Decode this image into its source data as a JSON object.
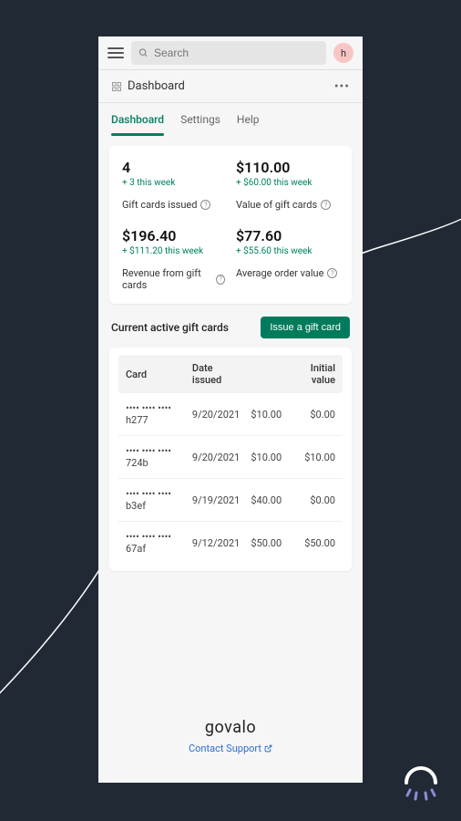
{
  "search": {
    "placeholder": "Search"
  },
  "avatar": {
    "initial": "h"
  },
  "breadcrumb": {
    "title": "Dashboard"
  },
  "tabs": [
    {
      "label": "Dashboard",
      "active": true
    },
    {
      "label": "Settings",
      "active": false
    },
    {
      "label": "Help",
      "active": false
    }
  ],
  "stats": [
    {
      "value": "4",
      "delta": "+ 3 this week",
      "label": "Gift cards issued"
    },
    {
      "value": "$110.00",
      "delta": "+ $60.00 this week",
      "label": "Value of gift cards"
    },
    {
      "value": "$196.40",
      "delta": "+ $111.20 this week",
      "label": "Revenue from gift cards"
    },
    {
      "value": "$77.60",
      "delta": "+ $55.60 this week",
      "label": "Average order value"
    }
  ],
  "active_section": {
    "title": "Current active gift cards",
    "button": "Issue a gift card"
  },
  "table": {
    "headers": [
      "Card",
      "Date issued",
      "",
      "Initial value"
    ],
    "rows": [
      {
        "card": "•••• •••• •••• h277",
        "date": "9/20/2021",
        "amt": "$10.00",
        "initial": "$0.00"
      },
      {
        "card": "•••• •••• •••• 724b",
        "date": "9/20/2021",
        "amt": "$10.00",
        "initial": "$10.00"
      },
      {
        "card": "•••• •••• •••• b3ef",
        "date": "9/19/2021",
        "amt": "$40.00",
        "initial": "$0.00"
      },
      {
        "card": "•••• •••• •••• 67af",
        "date": "9/12/2021",
        "amt": "$50.00",
        "initial": "$50.00"
      }
    ]
  },
  "footer": {
    "brand": "govalo",
    "support": "Contact Support"
  }
}
